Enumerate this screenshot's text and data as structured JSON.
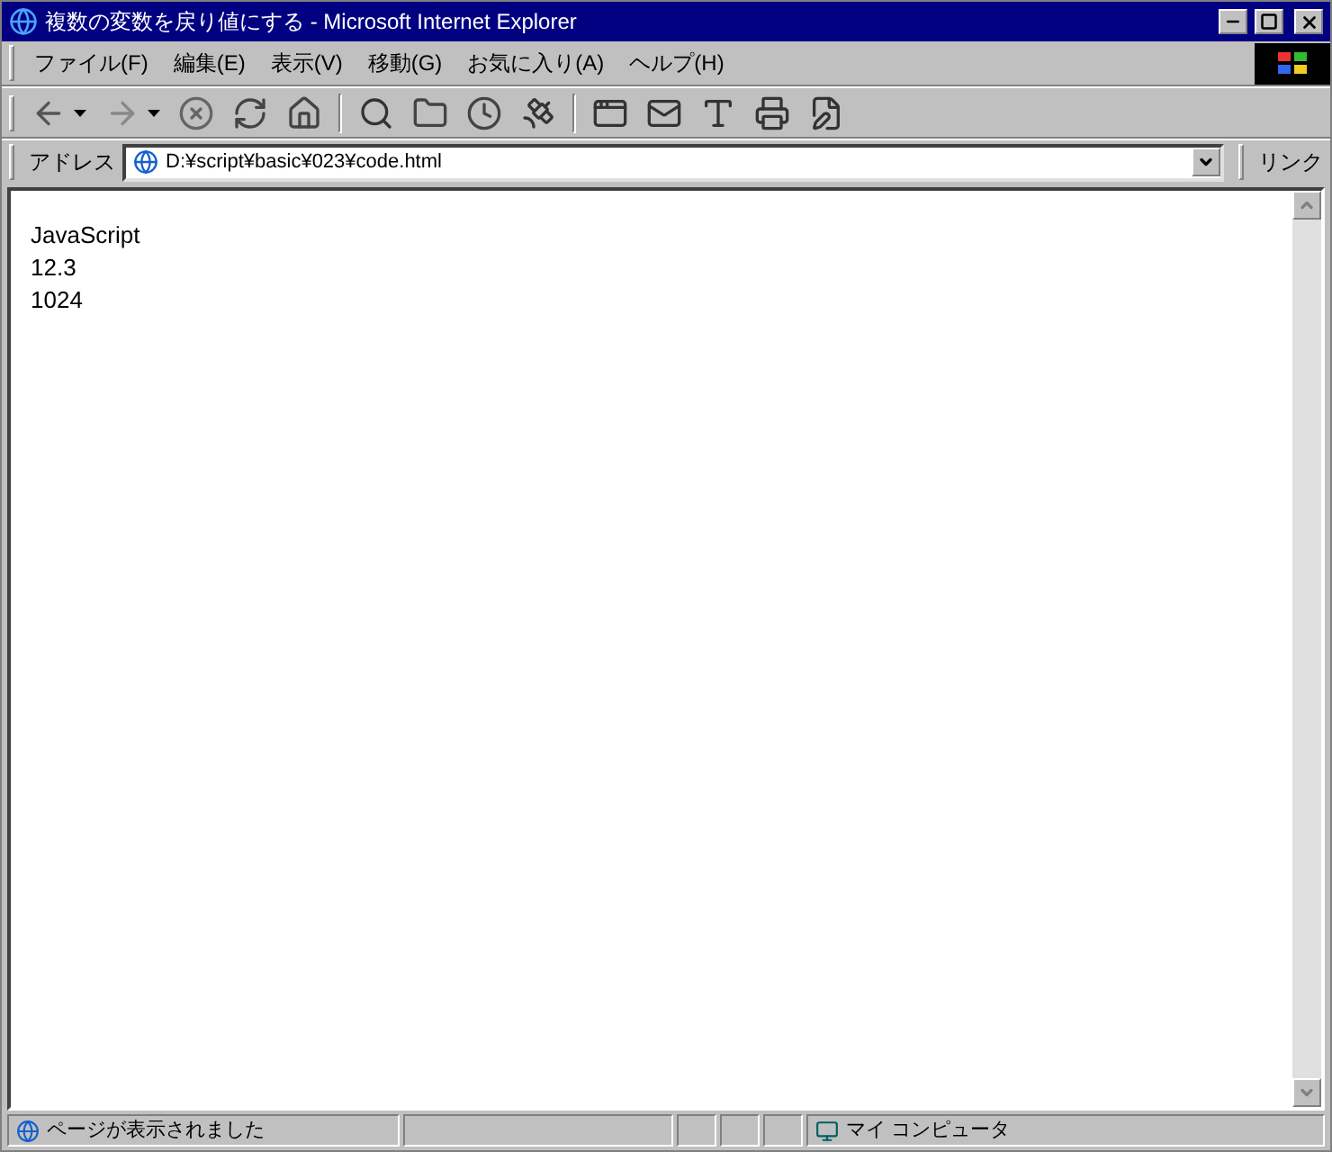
{
  "window": {
    "title": "複数の変数を戻り値にする - Microsoft Internet Explorer"
  },
  "menu": [
    "ファイル(F)",
    "編集(E)",
    "表示(V)",
    "移動(G)",
    "お気に入り(A)",
    "ヘルプ(H)"
  ],
  "toolbar": [
    {
      "kind": "back",
      "dropdown": true
    },
    {
      "kind": "forward",
      "dropdown": true
    },
    {
      "kind": "stop",
      "dropdown": false
    },
    {
      "kind": "refresh",
      "dropdown": false
    },
    {
      "kind": "home",
      "dropdown": false
    },
    {
      "kind": "separator"
    },
    {
      "kind": "search",
      "dropdown": false
    },
    {
      "kind": "favorites",
      "dropdown": false
    },
    {
      "kind": "history",
      "dropdown": false
    },
    {
      "kind": "channels",
      "dropdown": false
    },
    {
      "kind": "separator"
    },
    {
      "kind": "fullscreen",
      "dropdown": false
    },
    {
      "kind": "mail",
      "dropdown": false
    },
    {
      "kind": "font",
      "dropdown": false
    },
    {
      "kind": "print",
      "dropdown": false
    },
    {
      "kind": "edit",
      "dropdown": false
    }
  ],
  "address": {
    "label": "アドレス",
    "value": "D:¥script¥basic¥023¥code.html",
    "links": "リンク"
  },
  "content": [
    "JavaScript",
    "12.3",
    "1024"
  ],
  "status_bar": {
    "message": "ページが表示されました",
    "zone": "マイ コンピュータ"
  }
}
